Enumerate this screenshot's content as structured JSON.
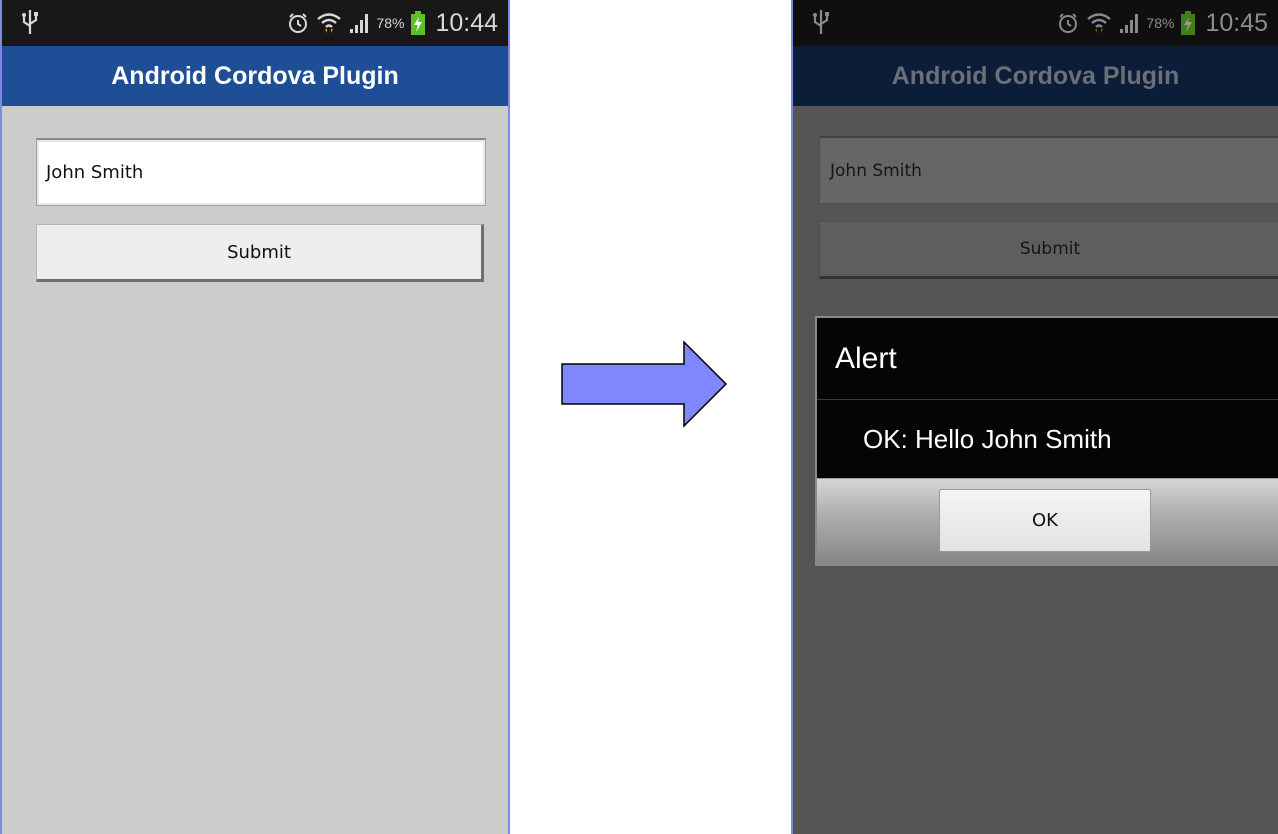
{
  "colors": {
    "accent_arrow": "#7f87ff",
    "title_bar": "#1e4e96",
    "screen_bg": "#cccccc",
    "dim_screen_bg": "#555555",
    "dialog_bg": "#050505"
  },
  "before": {
    "status": {
      "battery": "78%",
      "time": "10:44",
      "icons": [
        "usb-icon",
        "alarm-icon",
        "wifi-icon",
        "signal-icon",
        "battery-charging-icon"
      ]
    },
    "title": "Android Cordova Plugin",
    "name_field_value": "John Smith",
    "submit_label": "Submit"
  },
  "after": {
    "status": {
      "battery": "78%",
      "time": "10:45",
      "icons": [
        "usb-icon",
        "alarm-icon",
        "wifi-icon",
        "signal-icon",
        "battery-charging-icon"
      ]
    },
    "title": "Android Cordova Plugin",
    "name_field_value": "John Smith",
    "submit_label": "Submit",
    "dialog": {
      "title": "Alert",
      "message": "OK: Hello John Smith",
      "button_label": "OK"
    }
  }
}
